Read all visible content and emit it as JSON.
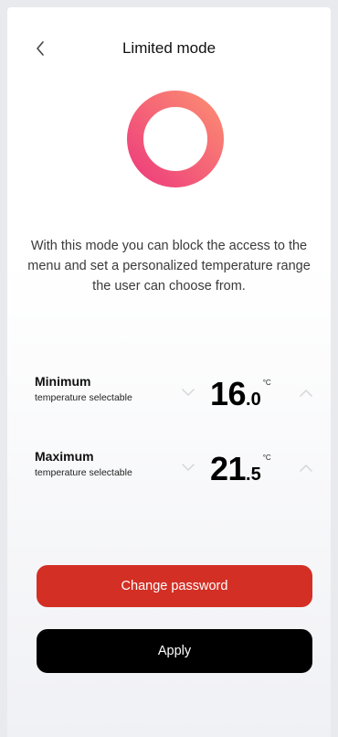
{
  "header": {
    "title": "Limited mode"
  },
  "description": "With this mode you can block the access to the menu and set a personalized temperature range the user can choose from.",
  "minimum": {
    "title": "Minimum",
    "subtitle": "temperature selectable",
    "value_int": "16",
    "value_dec": ".0",
    "unit": "°C"
  },
  "maximum": {
    "title": "Maximum",
    "subtitle": "temperature selectable",
    "value_int": "21",
    "value_dec": ".5",
    "unit": "°C"
  },
  "buttons": {
    "change_password": "Change password",
    "apply": "Apply"
  },
  "colors": {
    "accent_red": "#d32f25",
    "ring_pink": "#f0457a",
    "ring_coral": "#f98474",
    "apply_bg": "#000000"
  },
  "icons": {
    "back": "chevron-left-icon",
    "decrease": "chevron-down-icon",
    "increase": "chevron-up-icon",
    "mode_ring": "ring-icon"
  }
}
